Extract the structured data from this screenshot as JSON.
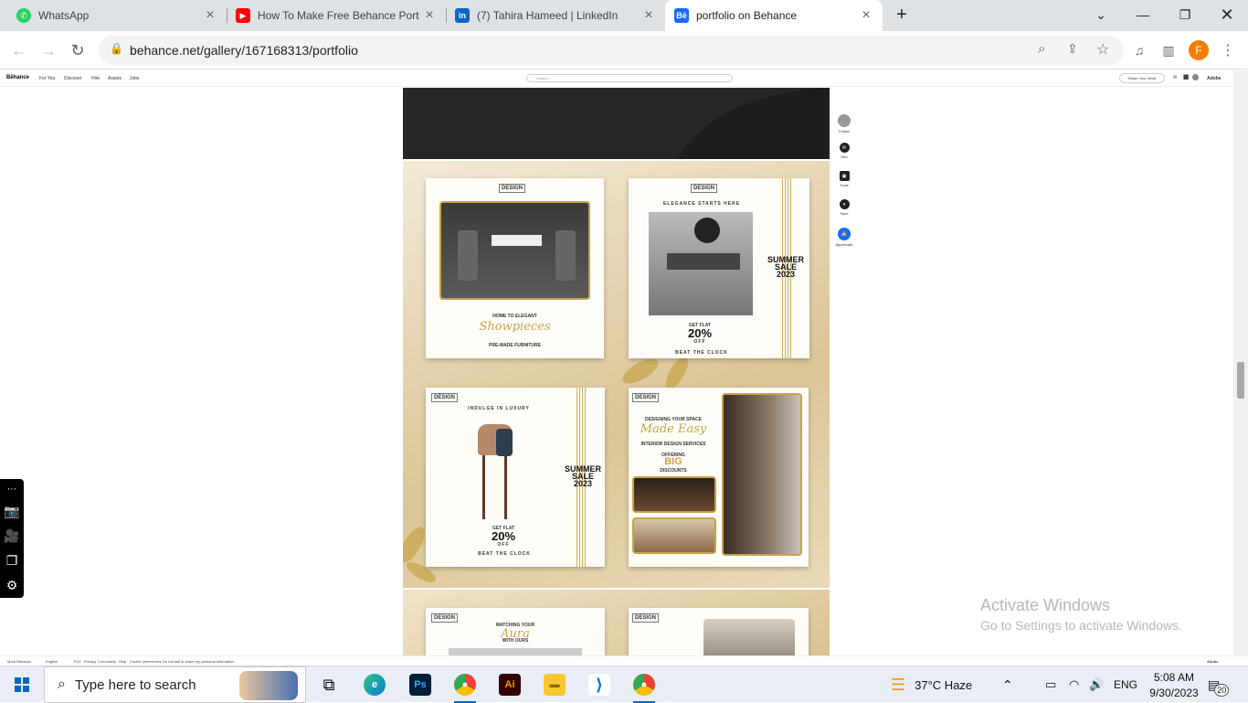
{
  "tabs": [
    {
      "title": "WhatsApp",
      "icon": "whatsapp-icon",
      "color": "#25d366"
    },
    {
      "title": "How To Make Free Behance Port",
      "icon": "youtube-icon",
      "color": "#ff0000"
    },
    {
      "title": "(7) Tahira Hameed | LinkedIn",
      "icon": "linkedin-icon",
      "color": "#0a66c2"
    },
    {
      "title": "portfolio on Behance",
      "icon": "behance-icon",
      "color": "#1769ff"
    }
  ],
  "browser": {
    "url": "behance.net/gallery/167168313/portfolio",
    "profile_initial": "F"
  },
  "behance_nav": {
    "logo": "Bēhance",
    "items": [
      "For You",
      "Discover",
      "Hire",
      "Assets",
      "Jobs"
    ],
    "search_placeholder": "Search...",
    "share_label": "Share Your Work",
    "adobe": "Adobe"
  },
  "side_rail": [
    {
      "label": "Follow",
      "icon": "avatar-icon"
    },
    {
      "label": "Hire",
      "icon": "mail-icon"
    },
    {
      "label": "Tools",
      "icon": "tools-icon"
    },
    {
      "label": "Save",
      "icon": "save-icon"
    },
    {
      "label": "Appreciate",
      "icon": "thumbs-up-icon"
    }
  ],
  "cards": {
    "c1": {
      "brand": "DESIGN",
      "line1": "HOME TO ELEGANT",
      "script": "Showpieces",
      "line2": "PRE-MADE FURNITURE"
    },
    "c2": {
      "brand": "DESIGN",
      "headline": "ELEGANCE STARTS HERE",
      "sale": "SUMMER SALE 2023",
      "get": "GET FLAT",
      "pct": "20%",
      "off": "OFF",
      "beat": "BEAT THE CLOCK"
    },
    "c3": {
      "brand": "DESIGN",
      "headline": "INDULGE IN LUXURY",
      "sale": "SUMMER SALE 2023",
      "get": "GET FLAT",
      "pct": "20%",
      "off": "OFF",
      "beat": "BEAT THE CLOCK"
    },
    "c4": {
      "brand": "DESIGN",
      "line1": "DESIGNING YOUR SPACE",
      "script": "Made Easy",
      "line2": "INTERIOR DESIGN SERVICES",
      "offering": "OFFERING",
      "big": "BIG",
      "discounts": "DISCOUNTS"
    },
    "c5": {
      "brand": "DESIGN",
      "line1": "MATCHING YOUR",
      "script": "Aura",
      "line2": "WITH OURS"
    },
    "c6": {
      "brand": "DESIGN"
    }
  },
  "activate": {
    "title": "Activate Windows",
    "subtitle": "Go to Settings to activate Windows."
  },
  "footer": {
    "items": [
      "More Behance",
      "English",
      "TOU",
      "Privacy",
      "Community",
      "Help",
      "Cookie preferences",
      "Do not sell or share my personal information"
    ],
    "adobe": "Adobe"
  },
  "taskbar": {
    "search_placeholder": "Type here to search",
    "weather": "37°C  Haze",
    "lang": "ENG",
    "time": "5:08 AM",
    "date": "9/30/2023",
    "notifications": "20"
  }
}
